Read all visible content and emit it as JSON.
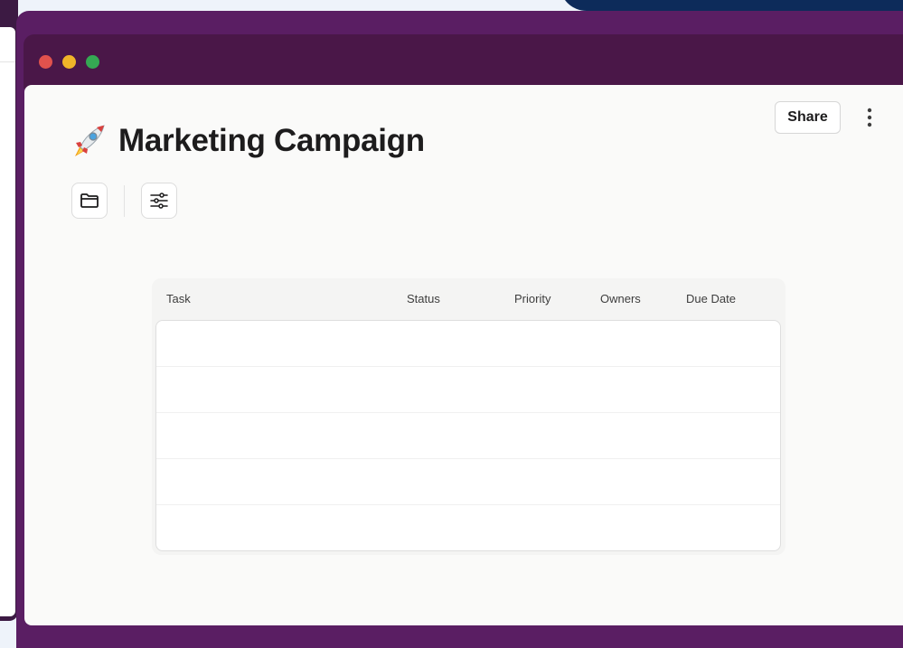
{
  "window": {
    "traffic_lights": {
      "close_color": "#e0524d",
      "minimize_color": "#f0b429",
      "maximize_color": "#35a853"
    },
    "frame_color": "#5a1e63"
  },
  "page": {
    "title_icon": "rocket-icon",
    "title": "Marketing Campaign"
  },
  "toolbar": {
    "folder_icon": "folder-icon",
    "filter_icon": "filter-sliders-icon"
  },
  "header_actions": {
    "share_label": "Share",
    "more_icon": "more-vertical-icon"
  },
  "table": {
    "columns": [
      "Task",
      "Status",
      "Priority",
      "Owners",
      "Due Date"
    ],
    "rows": [
      {
        "task": "",
        "status": "",
        "priority": "",
        "owners": "",
        "due_date": ""
      },
      {
        "task": "",
        "status": "",
        "priority": "",
        "owners": "",
        "due_date": ""
      },
      {
        "task": "",
        "status": "",
        "priority": "",
        "owners": "",
        "due_date": ""
      },
      {
        "task": "",
        "status": "",
        "priority": "",
        "owners": "",
        "due_date": ""
      },
      {
        "task": "",
        "status": "",
        "priority": "",
        "owners": "",
        "due_date": ""
      }
    ]
  }
}
